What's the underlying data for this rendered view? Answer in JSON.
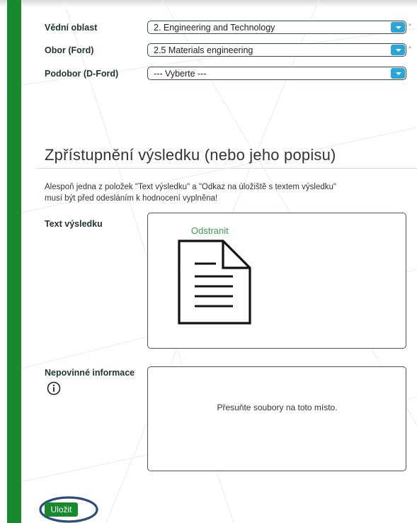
{
  "form": {
    "field_area_label": "Vědní oblast",
    "field_area_value": "2. Engineering and Technology",
    "field_branch_label": "Obor (Ford)",
    "field_branch_value": "2.5 Materials engineering",
    "field_subbranch_label": "Podobor (D-Ford)",
    "field_subbranch_value": "--- Vyberte ---",
    "required_mark": "*"
  },
  "section": {
    "title": "Zpřístupnění výsledku (nebo jeho popisu)",
    "note": "Alespoň jedna z položek \"Text výsledku\" a \"Odkaz na úložiště s textem výsledku\" musí být před odesláním k hodnocení vyplněna!"
  },
  "result_text": {
    "label": "Text výsledku",
    "remove_label": "Odstranit",
    "file_icon": "document-icon"
  },
  "optional_info": {
    "label": "Nepovinné informace",
    "info_icon": "info-icon",
    "drop_text": "Přesuňte soubory na toto místo."
  },
  "actions": {
    "save_label": "Uložit"
  },
  "colors": {
    "green": "#168a2c",
    "select_arrow": "#2aa5d8",
    "highlight_ring": "#2c4a7a"
  }
}
